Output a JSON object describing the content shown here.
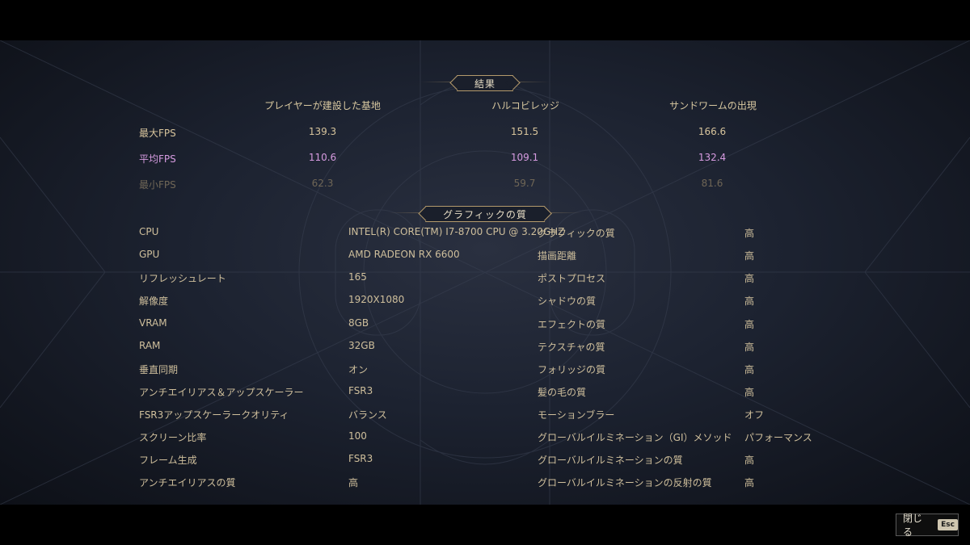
{
  "results": {
    "title": "結果",
    "columns": [
      "プレイヤーが建設した基地",
      "ハルコビレッジ",
      "サンドワームの出現"
    ],
    "rows": [
      {
        "label": "最大FPS",
        "values": [
          "139.3",
          "151.5",
          "166.6"
        ],
        "tone": "max"
      },
      {
        "label": "平均FPS",
        "values": [
          "110.6",
          "109.1",
          "132.4"
        ],
        "tone": "avg"
      },
      {
        "label": "最小FPS",
        "values": [
          "62.3",
          "59.7",
          "81.6"
        ],
        "tone": "min"
      }
    ]
  },
  "graphics": {
    "title": "グラフィックの質",
    "left": [
      {
        "label": "CPU",
        "value": "INTEL(R) CORE(TM) I7-8700 CPU @ 3.20GHZ"
      },
      {
        "label": "GPU",
        "value": "AMD RADEON RX 6600"
      },
      {
        "label": "リフレッシュレート",
        "value": "165"
      },
      {
        "label": "解像度",
        "value": "1920X1080"
      },
      {
        "label": "VRAM",
        "value": "8GB"
      },
      {
        "label": "RAM",
        "value": "32GB"
      },
      {
        "label": "垂直同期",
        "value": "オン"
      },
      {
        "label": "アンチエイリアス＆アップスケーラー",
        "value": "FSR3"
      },
      {
        "label": "FSR3アップスケーラークオリティ",
        "value": "バランス"
      },
      {
        "label": "スクリーン比率",
        "value": "100"
      },
      {
        "label": "フレーム生成",
        "value": "FSR3"
      },
      {
        "label": "アンチエイリアスの質",
        "value": "高"
      }
    ],
    "right": [
      {
        "label": "グラフィックの質",
        "value": "高"
      },
      {
        "label": "描画距離",
        "value": "高"
      },
      {
        "label": "ポストプロセス",
        "value": "高"
      },
      {
        "label": "シャドウの質",
        "value": "高"
      },
      {
        "label": "エフェクトの質",
        "value": "高"
      },
      {
        "label": "テクスチャの質",
        "value": "高"
      },
      {
        "label": "フォリッジの質",
        "value": "高"
      },
      {
        "label": "髪の毛の質",
        "value": "高"
      },
      {
        "label": "モーションブラー",
        "value": "オフ"
      },
      {
        "label": "グローバルイルミネーション（GI）メソッド",
        "value": "パフォーマンス"
      },
      {
        "label": "グローバルイルミネーションの質",
        "value": "高"
      },
      {
        "label": "グローバルイルミネーションの反射の質",
        "value": "高"
      }
    ]
  },
  "footer": {
    "close_label": "閉じる",
    "close_key": "Esc"
  },
  "colors": {
    "accent_gold": "#b49a6c",
    "avg_highlight": "#d69be0",
    "min_dim": "#6f6656"
  }
}
